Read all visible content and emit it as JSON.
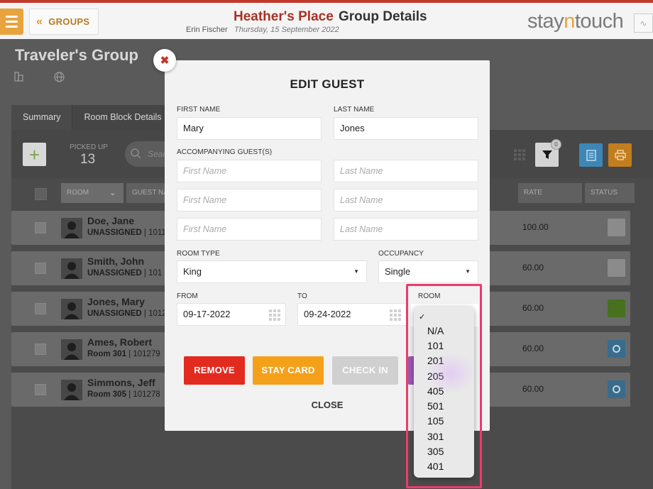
{
  "header": {
    "groups_label": "GROUPS",
    "hotel_name": "Heather's Place",
    "page_title": "Group Details",
    "user_name": "Erin Fischer",
    "business_date": "Thursday, 15 September 2022",
    "brand_prefix": "stay",
    "brand_accent": "n",
    "brand_suffix": "touch"
  },
  "group": {
    "title": "Traveler's Group",
    "tabs": [
      "Summary",
      "Room Block Details"
    ],
    "picked_up_label": "PICKED UP",
    "picked_up_value": "13",
    "search_placeholder": "Sear",
    "filter_count": "0",
    "columns": {
      "room": "ROOM",
      "guest": "GUEST NA",
      "rate": "RATE",
      "status": "STATUS"
    },
    "rows": [
      {
        "name": "Doe, Jane",
        "room": "UNASSIGNED",
        "id": "1011",
        "rate": "100.00",
        "status": "grey"
      },
      {
        "name": "Smith, John",
        "room": "UNASSIGNED",
        "id": "101",
        "rate": "60.00",
        "status": "grey"
      },
      {
        "name": "Jones, Mary",
        "room": "UNASSIGNED",
        "id": "1012",
        "rate": "60.00",
        "status": "green"
      },
      {
        "name": "Ames, Robert",
        "room": "Room 301",
        "id": "101279",
        "rate": "60.00",
        "status": "blue"
      },
      {
        "name": "Simmons, Jeff",
        "room": "Room 305",
        "id": "101278",
        "rate": "60.00",
        "status": "blue"
      }
    ]
  },
  "modal": {
    "title": "EDIT GUEST",
    "first_name_label": "FIRST NAME",
    "first_name_value": "Mary",
    "last_name_label": "LAST NAME",
    "last_name_value": "Jones",
    "accompanying_label": "ACCOMPANYING GUEST(S)",
    "first_name_ph": "First Name",
    "last_name_ph": "Last Name",
    "room_type_label": "ROOM TYPE",
    "room_type_value": "King",
    "occupancy_label": "OCCUPANCY",
    "occupancy_value": "Single",
    "from_label": "FROM",
    "from_value": "09-17-2022",
    "to_label": "TO",
    "to_value": "09-24-2022",
    "room_label": "ROOM",
    "remove_label": "REMOVE",
    "stay_card_label": "STAY CARD",
    "check_in_label": "CHECK IN",
    "close_label": "CLOSE"
  },
  "room_dropdown": {
    "checkmark": "✓",
    "options": [
      "N/A",
      "101",
      "201",
      "205",
      "405",
      "501",
      "105",
      "301",
      "305",
      "401"
    ]
  },
  "colors": {
    "brand_accent": "#e8a33d",
    "hotel_name": "#a83224",
    "remove": "#e22a1e",
    "stay_card": "#f5a01a",
    "highlight": "#ee3a6d"
  }
}
